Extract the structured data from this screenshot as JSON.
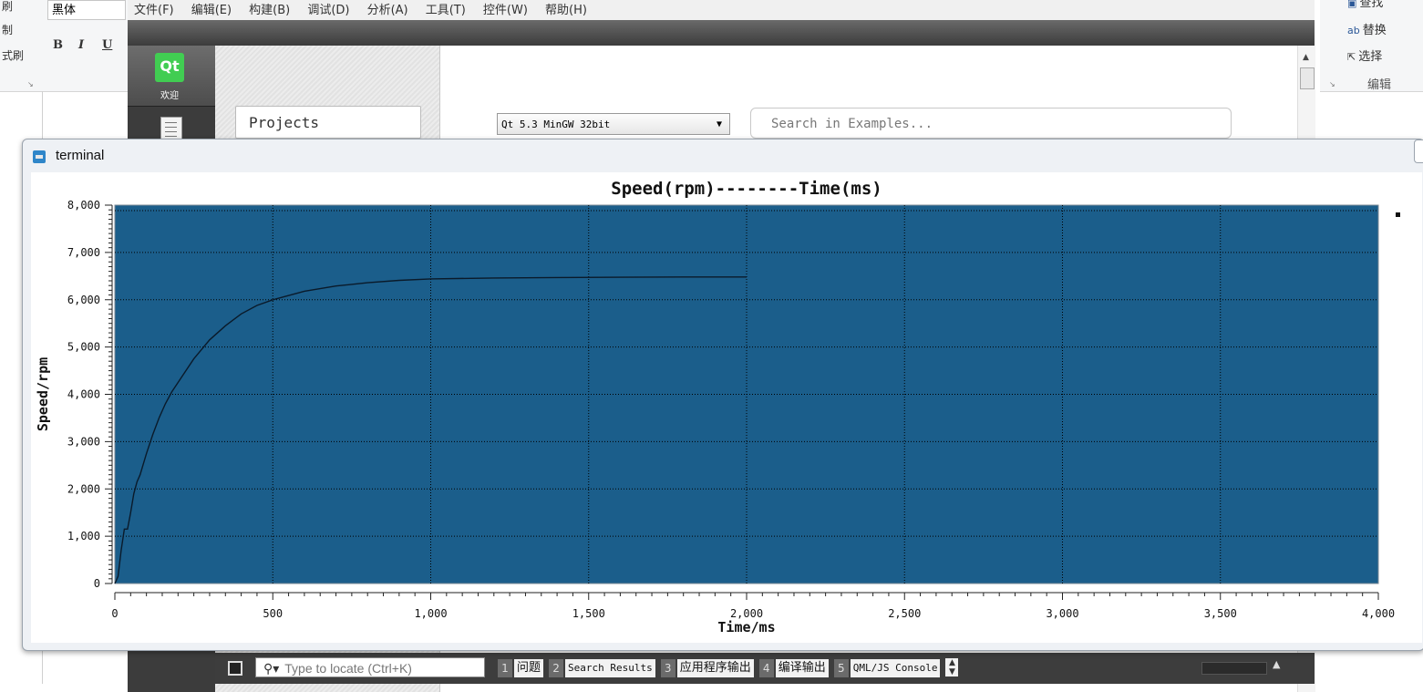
{
  "word_left": {
    "font_name": "黑体",
    "labels": [
      "刷",
      "制",
      "式刷"
    ],
    "bold": "B",
    "italic": "I",
    "underline": "U"
  },
  "word_right": {
    "find_label": "查找",
    "replace_label": "替换",
    "select_label": "选择",
    "group_label": "编辑"
  },
  "qt": {
    "menu": [
      "文件(F)",
      "编辑(E)",
      "构建(B)",
      "调试(D)",
      "分析(A)",
      "工具(T)",
      "控件(W)",
      "帮助(H)"
    ],
    "logo_text": "Qt",
    "mode_welcome": "欢迎",
    "projects_button": "Projects",
    "kit_select": "Qt 5.3 MinGW 32bit",
    "search_placeholder": "Search in Examples...",
    "locate_placeholder": "Type to locate (Ctrl+K)",
    "output_tabs": [
      {
        "num": "1",
        "label": "问题"
      },
      {
        "num": "2",
        "label": "Search Results"
      },
      {
        "num": "3",
        "label": "应用程序输出"
      },
      {
        "num": "4",
        "label": "编译输出"
      },
      {
        "num": "5",
        "label": "QML/JS Console"
      }
    ]
  },
  "terminal": {
    "title": "terminal"
  },
  "chart_data": {
    "type": "line",
    "title": "Speed(rpm)--------Time(ms)",
    "xlabel": "Time/ms",
    "ylabel": "Speed/rpm",
    "xlim": [
      0,
      4000
    ],
    "ylim": [
      0,
      8000
    ],
    "x_ticks": [
      0,
      500,
      1000,
      1500,
      2000,
      2500,
      3000,
      3500,
      4000
    ],
    "x_tick_labels": [
      "0",
      "500",
      "1,000",
      "1,500",
      "2,000",
      "2,500",
      "3,000",
      "3,500",
      "4,000"
    ],
    "y_ticks": [
      0,
      1000,
      2000,
      3000,
      4000,
      5000,
      6000,
      7000,
      8000
    ],
    "y_tick_labels": [
      "0",
      "1,000",
      "2,000",
      "3,000",
      "4,000",
      "5,000",
      "6,000",
      "7,000",
      "8,000"
    ],
    "grid": true,
    "plot_background": "#1b5e8b",
    "line_color": "#0a1a2a",
    "series": [
      {
        "x": [
          0,
          10,
          20,
          30,
          40,
          50,
          60,
          70,
          80,
          100,
          120,
          140,
          160,
          180,
          200,
          250,
          300,
          350,
          400,
          450,
          500,
          600,
          700,
          800,
          900,
          1000,
          1200,
          1400,
          1600,
          1800,
          2000
        ],
        "values": [
          0,
          150,
          700,
          1150,
          1150,
          1500,
          1900,
          2150,
          2300,
          2750,
          3150,
          3500,
          3800,
          4050,
          4250,
          4750,
          5150,
          5450,
          5700,
          5880,
          6000,
          6180,
          6290,
          6360,
          6410,
          6440,
          6460,
          6470,
          6475,
          6480,
          6480
        ]
      }
    ]
  }
}
